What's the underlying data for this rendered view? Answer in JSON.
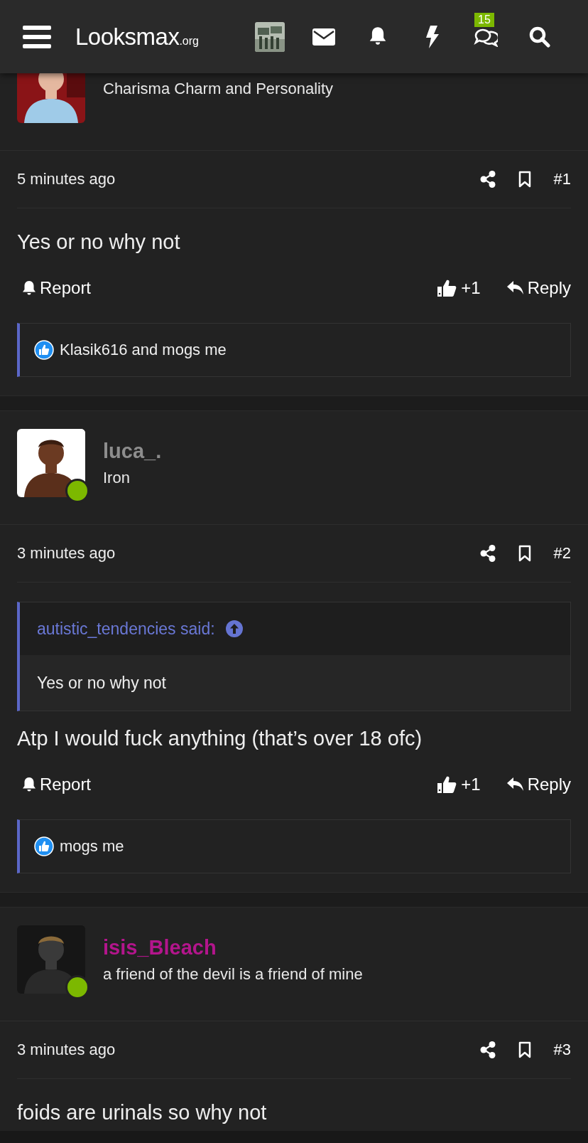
{
  "header": {
    "logo": "Looksmax",
    "logo_suffix": ".org",
    "chat_badge": "15"
  },
  "posts": [
    {
      "user": {
        "title": "Charisma Charm and Personality"
      },
      "time": "5 minutes ago",
      "number": "#1",
      "body": "Yes or no why not",
      "report": "Report",
      "likes": "+1",
      "reply": "Reply",
      "reactions": "Klasik616 and mogs me"
    },
    {
      "user": {
        "name": "luca_.",
        "color": "#8d8d8d",
        "title": "Iron",
        "online": true
      },
      "time": "3 minutes ago",
      "number": "#2",
      "quote": {
        "author": "autistic_tendencies said:",
        "text": "Yes or no why not"
      },
      "body": "Atp I would fuck anything (that’s over 18 ofc)",
      "report": "Report",
      "likes": "+1",
      "reply": "Reply",
      "reactions": "mogs me"
    },
    {
      "user": {
        "name": "isis_Bleach",
        "color": "#b3158c",
        "title": "a friend of the devil is a friend of mine",
        "online": true
      },
      "time": "3 minutes ago",
      "number": "#3",
      "body": "foids are urinals so why not"
    }
  ]
}
